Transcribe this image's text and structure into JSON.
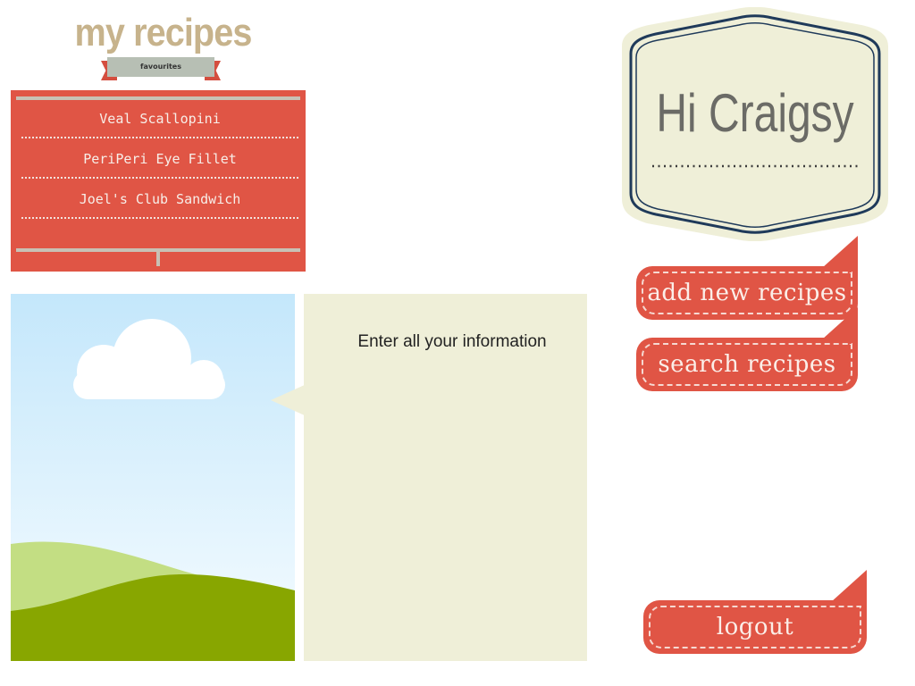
{
  "header": {
    "title": "my recipes",
    "favourites_label": "favourites"
  },
  "favourites": {
    "items": [
      "Veal Scallopini",
      "PeriPeri Eye Fillet",
      "Joel's Club Sandwich"
    ]
  },
  "info": {
    "prompt": "Enter all your information"
  },
  "greeting": {
    "text": "Hi Craigsy"
  },
  "actions": {
    "add_label": "add new recipes",
    "search_label": "search recipes",
    "logout_label": "logout"
  },
  "colors": {
    "accent_red": "#e05545",
    "title_tan": "#c7b38c",
    "panel_cream": "#efefd8",
    "badge_navy": "#1f3a5a"
  }
}
